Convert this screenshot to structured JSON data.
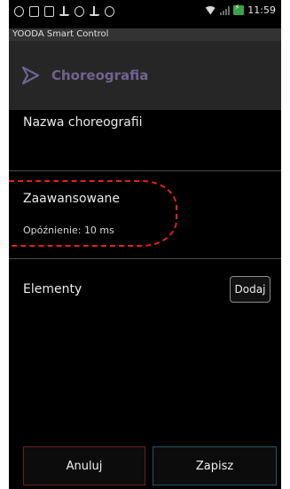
{
  "status_bar": {
    "time": "11:59",
    "left_icons": [
      "notification-icon",
      "sim-icon",
      "screenshot-icon",
      "download-icon",
      "sync-icon",
      "upload-icon",
      "android-icon"
    ]
  },
  "app": {
    "window_title": "YOODA Smart Control",
    "action_bar_title": "Choreografia",
    "accent_color": "#6e6490"
  },
  "form": {
    "name_label": "Nazwa choreografii",
    "advanced_title": "Zaawansowane",
    "delay_text": "Opóźnienie: 10 ms",
    "elements_label": "Elementy",
    "add_button": "Dodaj"
  },
  "footer": {
    "cancel_button": "Anuluj",
    "save_button": "Zapisz"
  }
}
